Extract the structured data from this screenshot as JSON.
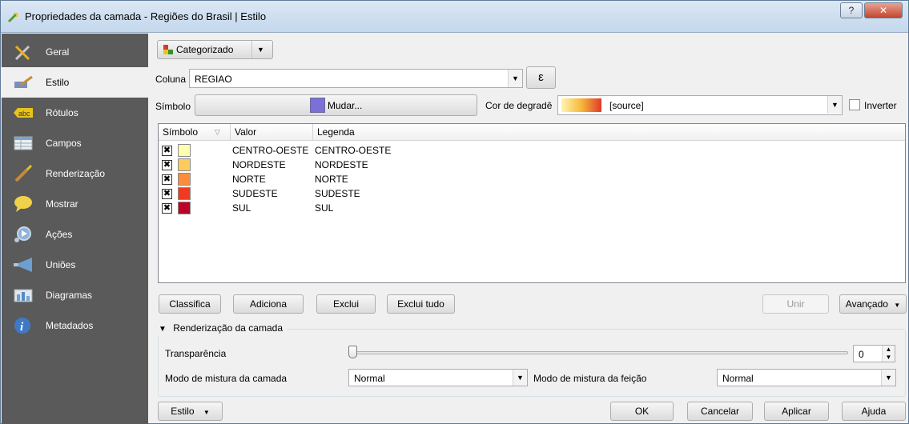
{
  "window": {
    "title": "Propriedades da camada - Regiões do Brasil | Estilo",
    "help_glyph": "?",
    "close_glyph": "✕"
  },
  "sidebar": {
    "items": [
      {
        "label": "Geral",
        "icon": "tools-icon"
      },
      {
        "label": "Estilo",
        "icon": "paint-brush-icon"
      },
      {
        "label": "Rótulos",
        "icon": "abc-label-icon"
      },
      {
        "label": "Campos",
        "icon": "table-icon"
      },
      {
        "label": "Renderização",
        "icon": "brush-icon"
      },
      {
        "label": "Mostrar",
        "icon": "speech-bubble-icon"
      },
      {
        "label": "Ações",
        "icon": "gear-play-icon"
      },
      {
        "label": "Uniões",
        "icon": "join-icon"
      },
      {
        "label": "Diagramas",
        "icon": "chart-icon"
      },
      {
        "label": "Metadados",
        "icon": "info-icon"
      }
    ]
  },
  "renderer": {
    "type": "Categorizado"
  },
  "column": {
    "label": "Coluna",
    "value": "REGIAO",
    "expr_button": "ε"
  },
  "symbol": {
    "label": "Símbolo",
    "button": "Mudar...",
    "color": "#7b70d8"
  },
  "ramp": {
    "label": "Cor de degradê",
    "value": "[source]",
    "invert_label": "Inverter"
  },
  "table": {
    "headers": [
      "Símbolo",
      "Valor",
      "Legenda"
    ],
    "rows": [
      {
        "value": "CENTRO-OESTE",
        "legend": "CENTRO-OESTE",
        "color": "#ffffb2",
        "checked": "✖"
      },
      {
        "value": "NORDESTE",
        "legend": "NORDESTE",
        "color": "#fecc5c",
        "checked": "✖"
      },
      {
        "value": "NORTE",
        "legend": "NORTE",
        "color": "#fd8d3c",
        "checked": "✖"
      },
      {
        "value": "SUDESTE",
        "legend": "SUDESTE",
        "color": "#f03b20",
        "checked": "✖"
      },
      {
        "value": "SUL",
        "legend": "SUL",
        "color": "#bd0026",
        "checked": "✖"
      }
    ]
  },
  "actions": {
    "classify": "Classifica",
    "add": "Adiciona",
    "delete": "Exclui",
    "delete_all": "Exclui tudo",
    "join": "Unir",
    "advanced": "Avançado"
  },
  "layer_rendering": {
    "title": "Renderização da camada",
    "transparency_label": "Transparência",
    "transparency_value": "0",
    "layer_blend_label": "Modo de mistura da camada",
    "layer_blend_value": "Normal",
    "feature_blend_label": "Modo de mistura da feição",
    "feature_blend_value": "Normal"
  },
  "footer": {
    "style": "Estilo",
    "ok": "OK",
    "cancel": "Cancelar",
    "apply": "Aplicar",
    "help": "Ajuda"
  }
}
